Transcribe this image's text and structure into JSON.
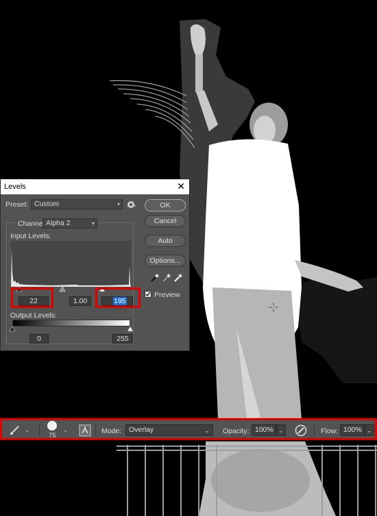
{
  "levels_dialog": {
    "title": "Levels",
    "preset_label": "Preset:",
    "preset_value": "Custom",
    "channel_label": "Channel:",
    "channel_value": "Alpha 2",
    "input_levels_label": "Input Levels:",
    "input_black": "22",
    "input_gamma": "1.00",
    "input_white": "195",
    "output_levels_label": "Output Levels:",
    "output_black": "0",
    "output_white": "255",
    "buttons": {
      "ok": "OK",
      "cancel": "Cancel",
      "auto": "Auto",
      "options": "Options..."
    },
    "preview_label": "Preview",
    "preview_checked": true
  },
  "options_bar": {
    "brush_size": "75",
    "mode_label": "Mode:",
    "mode_value": "Overlay",
    "opacity_label": "Opacity:",
    "opacity_value": "100%",
    "flow_label": "Flow:",
    "flow_value": "100%"
  },
  "colors": {
    "panel": "#535353",
    "highlight": "#e00000",
    "selection": "#1f6fd1"
  },
  "icons": [
    "brush-tool-icon",
    "brush-preset-icon",
    "brush-settings-icon",
    "settings-gear-icon",
    "black-eyedropper-icon",
    "gray-eyedropper-icon",
    "white-eyedropper-icon",
    "pressure-opacity-icon",
    "close-icon",
    "crosshair-cursor-icon"
  ]
}
